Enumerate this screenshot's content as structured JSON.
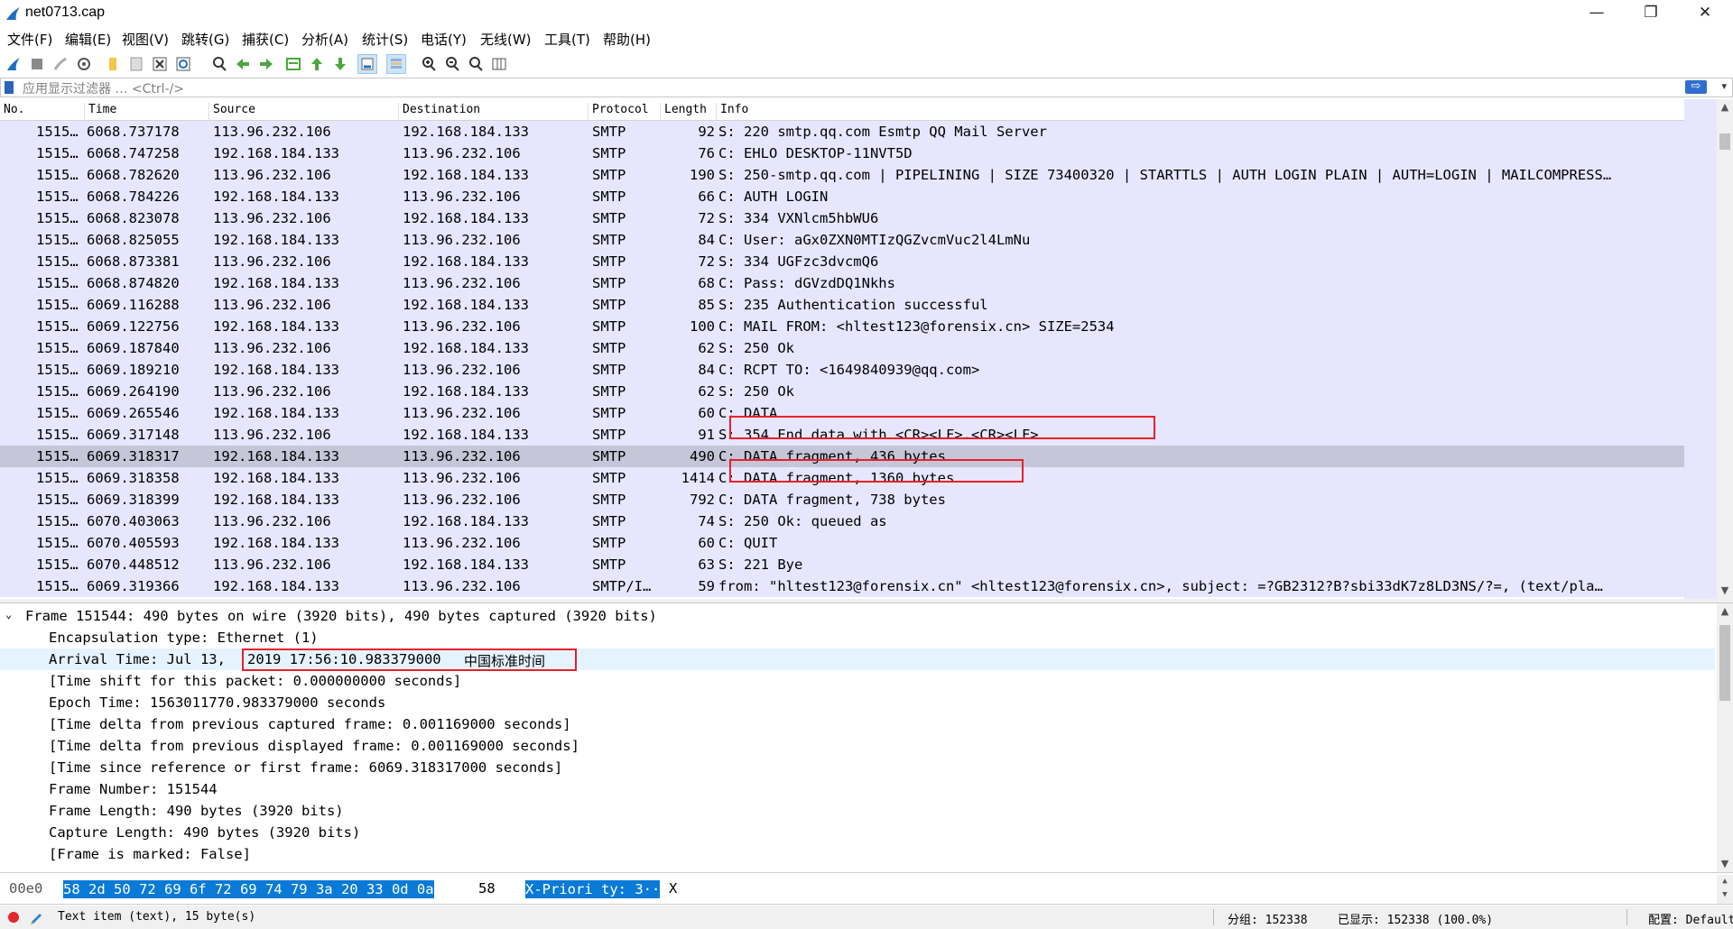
{
  "window": {
    "title": "net0713.cap",
    "minimize": "—",
    "maximize": "❐",
    "close": "✕"
  },
  "menu": [
    "文件(F)",
    "编辑(E)",
    "视图(V)",
    "跳转(G)",
    "捕获(C)",
    "分析(A)",
    "统计(S)",
    "电话(Y)",
    "无线(W)",
    "工具(T)",
    "帮助(H)"
  ],
  "toolbar": {
    "icons": [
      "start-capture-icon",
      "stop-capture-icon",
      "restart-capture-icon",
      "capture-options-icon",
      "open-file-icon",
      "save-file-icon",
      "close-file-icon",
      "reload-file-icon",
      "find-packet-icon",
      "go-back-icon",
      "go-forward-icon",
      "go-to-packet-icon",
      "go-first-icon",
      "go-last-icon",
      "auto-scroll-icon",
      "colorize-icon",
      "zoom-in-icon",
      "zoom-out-icon",
      "normal-size-icon",
      "resize-columns-icon"
    ]
  },
  "filter": {
    "placeholder": "应用显示过滤器 … <Ctrl-/>",
    "apply_icon": "⇨",
    "dropdown": "▾"
  },
  "columns": {
    "no": "No.",
    "time": "Time",
    "source": "Source",
    "destination": "Destination",
    "protocol": "Protocol",
    "length": "Length",
    "info": "Info"
  },
  "packets": [
    {
      "no": "1515…",
      "time": "6068.737178",
      "src": "113.96.232.106",
      "dst": "192.168.184.133",
      "proto": "SMTP",
      "len": "92",
      "info": "S: 220 smtp.qq.com Esmtp QQ Mail Server"
    },
    {
      "no": "1515…",
      "time": "6068.747258",
      "src": "192.168.184.133",
      "dst": "113.96.232.106",
      "proto": "SMTP",
      "len": "76",
      "info": "C: EHLO DESKTOP-11NVT5D"
    },
    {
      "no": "1515…",
      "time": "6068.782620",
      "src": "113.96.232.106",
      "dst": "192.168.184.133",
      "proto": "SMTP",
      "len": "190",
      "info": "S: 250-smtp.qq.com | PIPELINING | SIZE 73400320 | STARTTLS | AUTH LOGIN PLAIN | AUTH=LOGIN | MAILCOMPRESS…"
    },
    {
      "no": "1515…",
      "time": "6068.784226",
      "src": "192.168.184.133",
      "dst": "113.96.232.106",
      "proto": "SMTP",
      "len": "66",
      "info": "C: AUTH LOGIN"
    },
    {
      "no": "1515…",
      "time": "6068.823078",
      "src": "113.96.232.106",
      "dst": "192.168.184.133",
      "proto": "SMTP",
      "len": "72",
      "info": "S: 334 VXNlcm5hbWU6"
    },
    {
      "no": "1515…",
      "time": "6068.825055",
      "src": "192.168.184.133",
      "dst": "113.96.232.106",
      "proto": "SMTP",
      "len": "84",
      "info": "C: User: aGx0ZXN0MTIzQGZvcmVuc2l4LmNu"
    },
    {
      "no": "1515…",
      "time": "6068.873381",
      "src": "113.96.232.106",
      "dst": "192.168.184.133",
      "proto": "SMTP",
      "len": "72",
      "info": "S: 334 UGFzc3dvcmQ6"
    },
    {
      "no": "1515…",
      "time": "6068.874820",
      "src": "192.168.184.133",
      "dst": "113.96.232.106",
      "proto": "SMTP",
      "len": "68",
      "info": "C: Pass: dGVzdDQ1Nkhs"
    },
    {
      "no": "1515…",
      "time": "6069.116288",
      "src": "113.96.232.106",
      "dst": "192.168.184.133",
      "proto": "SMTP",
      "len": "85",
      "info": "S: 235 Authentication successful"
    },
    {
      "no": "1515…",
      "time": "6069.122756",
      "src": "192.168.184.133",
      "dst": "113.96.232.106",
      "proto": "SMTP",
      "len": "100",
      "info": "C: MAIL FROM: <hltest123@forensix.cn> SIZE=2534"
    },
    {
      "no": "1515…",
      "time": "6069.187840",
      "src": "113.96.232.106",
      "dst": "192.168.184.133",
      "proto": "SMTP",
      "len": "62",
      "info": "S: 250 Ok"
    },
    {
      "no": "1515…",
      "time": "6069.189210",
      "src": "192.168.184.133",
      "dst": "113.96.232.106",
      "proto": "SMTP",
      "len": "84",
      "info": "C: RCPT TO: <1649840939@qq.com>"
    },
    {
      "no": "1515…",
      "time": "6069.264190",
      "src": "113.96.232.106",
      "dst": "192.168.184.133",
      "proto": "SMTP",
      "len": "62",
      "info": "S: 250 Ok"
    },
    {
      "no": "1515…",
      "time": "6069.265546",
      "src": "192.168.184.133",
      "dst": "113.96.232.106",
      "proto": "SMTP",
      "len": "60",
      "info": "C: DATA"
    },
    {
      "no": "1515…",
      "time": "6069.317148",
      "src": "113.96.232.106",
      "dst": "192.168.184.133",
      "proto": "SMTP",
      "len": "91",
      "info": "S: 354 End data with <CR><LF>.<CR><LF>"
    },
    {
      "no": "1515…",
      "time": "6069.318317",
      "src": "192.168.184.133",
      "dst": "113.96.232.106",
      "proto": "SMTP",
      "len": "490",
      "info": "C: DATA fragment, 436 bytes"
    },
    {
      "no": "1515…",
      "time": "6069.318358",
      "src": "192.168.184.133",
      "dst": "113.96.232.106",
      "proto": "SMTP",
      "len": "1414",
      "info": "C: DATA fragment, 1360 bytes"
    },
    {
      "no": "1515…",
      "time": "6069.318399",
      "src": "192.168.184.133",
      "dst": "113.96.232.106",
      "proto": "SMTP",
      "len": "792",
      "info": "C: DATA fragment, 738 bytes"
    },
    {
      "no": "1515…",
      "time": "6070.403063",
      "src": "113.96.232.106",
      "dst": "192.168.184.133",
      "proto": "SMTP",
      "len": "74",
      "info": "S: 250 Ok: queued as"
    },
    {
      "no": "1515…",
      "time": "6070.405593",
      "src": "192.168.184.133",
      "dst": "113.96.232.106",
      "proto": "SMTP",
      "len": "60",
      "info": "C: QUIT"
    },
    {
      "no": "1515…",
      "time": "6070.448512",
      "src": "113.96.232.106",
      "dst": "192.168.184.133",
      "proto": "SMTP",
      "len": "63",
      "info": "S: 221 Bye"
    },
    {
      "no": "1515…",
      "time": "6069.319366",
      "src": "192.168.184.133",
      "dst": "113.96.232.106",
      "proto": "SMTP/I…",
      "len": "59",
      "info": "from: \"hltest123@forensix.cn\" <hltest123@forensix.cn>, subject: =?GB2312?B?sbi33dK7z8LD3NS/?=,  (text/pla…"
    }
  ],
  "selected_packet_index": 15,
  "details": {
    "frame": "Frame 151544: 490 bytes on wire (3920 bits), 490 bytes captured (3920 bits)",
    "encapsulation": "Encapsulation type: Ethernet (1)",
    "arrival_prefix": "Arrival Time: Jul 13,",
    "arrival_value": "2019 17:56:10.983379000",
    "arrival_tz": "中国标准时间",
    "time_shift": "[Time shift for this packet: 0.000000000 seconds]",
    "epoch": "Epoch Time: 1563011770.983379000 seconds",
    "delta_captured": "[Time delta from previous captured frame: 0.001169000 seconds]",
    "delta_displayed": "[Time delta from previous displayed frame: 0.001169000 seconds]",
    "since_ref": "[Time since reference or first frame: 6069.318317000 seconds]",
    "frame_number": "Frame Number: 151544",
    "frame_length": "Frame Length: 490 bytes (3920 bits)",
    "capture_length": "Capture Length: 490 bytes (3920 bits)",
    "marked": "[Frame is marked: False]"
  },
  "bytes": {
    "offset": "00e0",
    "hex_selected": "58 2d 50 72 69 6f 72 69  74 79 3a 20 33 0d 0a",
    "hex_rest": "58",
    "ascii_selected": "X-Priori ty: 3··",
    "ascii_rest": "X"
  },
  "status": {
    "item": "Text item (text), 15 byte(s)",
    "packets": "分组: 152338",
    "displayed": "已显示: 152338 (100.0%)",
    "profile": "配置: Default"
  }
}
